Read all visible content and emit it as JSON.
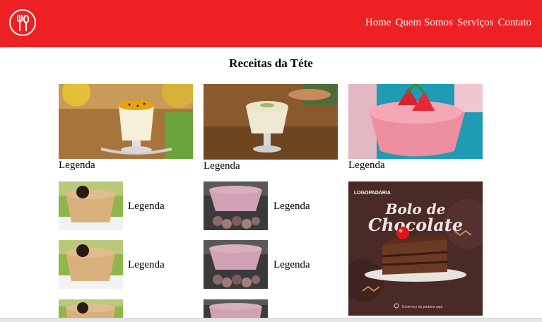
{
  "nav": {
    "home": "Home",
    "about": "Quem Somos",
    "services": "Serviços",
    "contact": "Contato"
  },
  "page": {
    "title": "Receitas da Téte"
  },
  "captions": {
    "c1": "Legenda",
    "c2": "Legenda",
    "c3": "Legenda",
    "c4": "Legenda",
    "c5": "Legenda",
    "c6": "Legenda",
    "c7": "Legenda"
  },
  "poster": {
    "brand": "LOGOPADARIA",
    "line1": "Bolo de",
    "line2": "Chocolate",
    "footer": "Endereço da padaria aqui"
  },
  "colors": {
    "header": "#ed2024",
    "text": "#000000"
  }
}
